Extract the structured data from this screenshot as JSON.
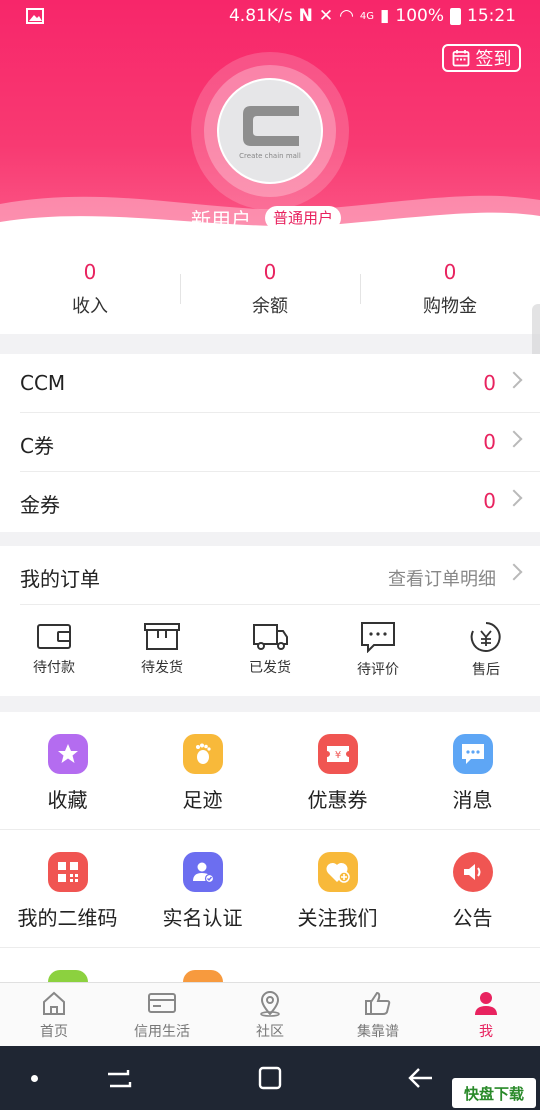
{
  "status_bar": {
    "speed": "4.81K/s",
    "network": "4G",
    "battery": "100%",
    "time": "15:21"
  },
  "header": {
    "signin_label": "签到",
    "avatar_logo_text": "Create chain mall",
    "username": "新用户",
    "user_type": "普通用户"
  },
  "stats": [
    {
      "value": "0",
      "label": "收入"
    },
    {
      "value": "0",
      "label": "余额"
    },
    {
      "value": "0",
      "label": "购物金"
    }
  ],
  "balances": [
    {
      "name": "CCM",
      "value": "0"
    },
    {
      "name": "C券",
      "value": "0"
    },
    {
      "name": "金券",
      "value": "0"
    }
  ],
  "orders": {
    "title": "我的订单",
    "link": "查看订单明细",
    "items": [
      {
        "label": "待付款",
        "icon": "wallet-icon"
      },
      {
        "label": "待发货",
        "icon": "package-icon"
      },
      {
        "label": "已发货",
        "icon": "truck-icon"
      },
      {
        "label": "待评价",
        "icon": "comment-icon"
      },
      {
        "label": "售后",
        "icon": "refund-icon"
      }
    ]
  },
  "grid": [
    {
      "label": "收藏",
      "icon": "star-icon",
      "color": "#b46cf0"
    },
    {
      "label": "足迹",
      "icon": "footprint-icon",
      "color": "#f8b93a"
    },
    {
      "label": "优惠券",
      "icon": "coupon-icon",
      "color": "#f05552"
    },
    {
      "label": "消息",
      "icon": "message-icon",
      "color": "#5ea6f5"
    },
    {
      "label": "我的二维码",
      "icon": "qrcode-icon",
      "color": "#f05552"
    },
    {
      "label": "实名认证",
      "icon": "user-verify-icon",
      "color": "#6c6ef0"
    },
    {
      "label": "关注我们",
      "icon": "heart-plus-icon",
      "color": "#f8b93a"
    },
    {
      "label": "公告",
      "icon": "speaker-icon",
      "color": "#f05552"
    }
  ],
  "tabbar": [
    {
      "label": "首页",
      "icon": "home-icon",
      "active": false
    },
    {
      "label": "信用生活",
      "icon": "card-icon",
      "active": false
    },
    {
      "label": "社区",
      "icon": "location-icon",
      "active": false
    },
    {
      "label": "集靠谱",
      "icon": "thumbs-up-icon",
      "active": false
    },
    {
      "label": "我",
      "icon": "person-icon",
      "active": true
    }
  ],
  "watermark": "快盘下载",
  "colors": {
    "brand": "#f7266a",
    "accent": "#e8235f"
  }
}
